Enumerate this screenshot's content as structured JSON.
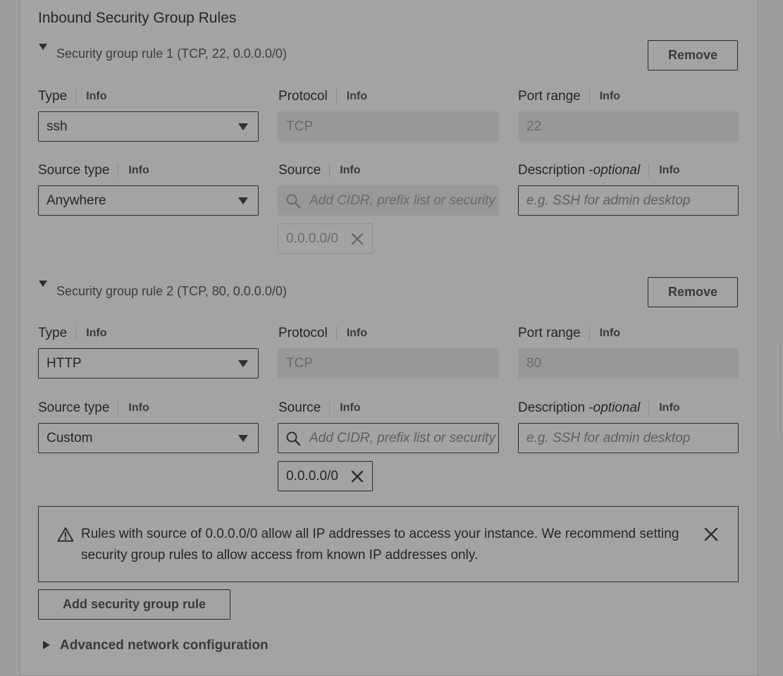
{
  "section": {
    "title": "Inbound Security Group Rules",
    "add_rule_label": "Add security group rule",
    "advanced_label": "Advanced network configuration"
  },
  "rules": [
    {
      "header": "Security group rule 1 (TCP, 22, 0.0.0.0/0)",
      "remove_label": "Remove",
      "type_label": "Type",
      "type_value": "ssh",
      "protocol_label": "Protocol",
      "protocol_value": "TCP",
      "port_label": "Port range",
      "port_value": "22",
      "source_type_label": "Source type",
      "source_type_value": "Anywhere",
      "source_label": "Source",
      "source_placeholder": "Add CIDR, prefix list or security",
      "source_token": "0.0.0.0/0",
      "description_label": "Description - ",
      "description_optional": "optional",
      "description_placeholder": "e.g. SSH for admin desktop",
      "info": "Info"
    },
    {
      "header": "Security group rule 2 (TCP, 80, 0.0.0.0/0)",
      "remove_label": "Remove",
      "type_label": "Type",
      "type_value": "HTTP",
      "protocol_label": "Protocol",
      "protocol_value": "TCP",
      "port_label": "Port range",
      "port_value": "80",
      "source_type_label": "Source type",
      "source_type_value": "Custom",
      "source_label": "Source",
      "source_placeholder": "Add CIDR, prefix list or security",
      "source_token": "0.0.0.0/0",
      "description_label": "Description - ",
      "description_optional": "optional",
      "description_placeholder": "e.g. SSH for admin desktop",
      "info": "Info"
    }
  ],
  "alert": {
    "text": "Rules with source of 0.0.0.0/0 allow all IP addresses to access your instance. We recommend setting security group rules to allow access from known IP addresses only."
  },
  "colors": {
    "overlay_background": "#9e9e9e",
    "panel_background": "#a3a3a3",
    "text": "#232323"
  },
  "icons": {
    "expand": "caret-down-icon",
    "collapsed": "caret-right-icon",
    "dropdown": "dropdown-arrow-icon",
    "search": "search-icon",
    "remove_token": "close-icon",
    "warning": "warning-icon",
    "dismiss": "close-icon"
  }
}
